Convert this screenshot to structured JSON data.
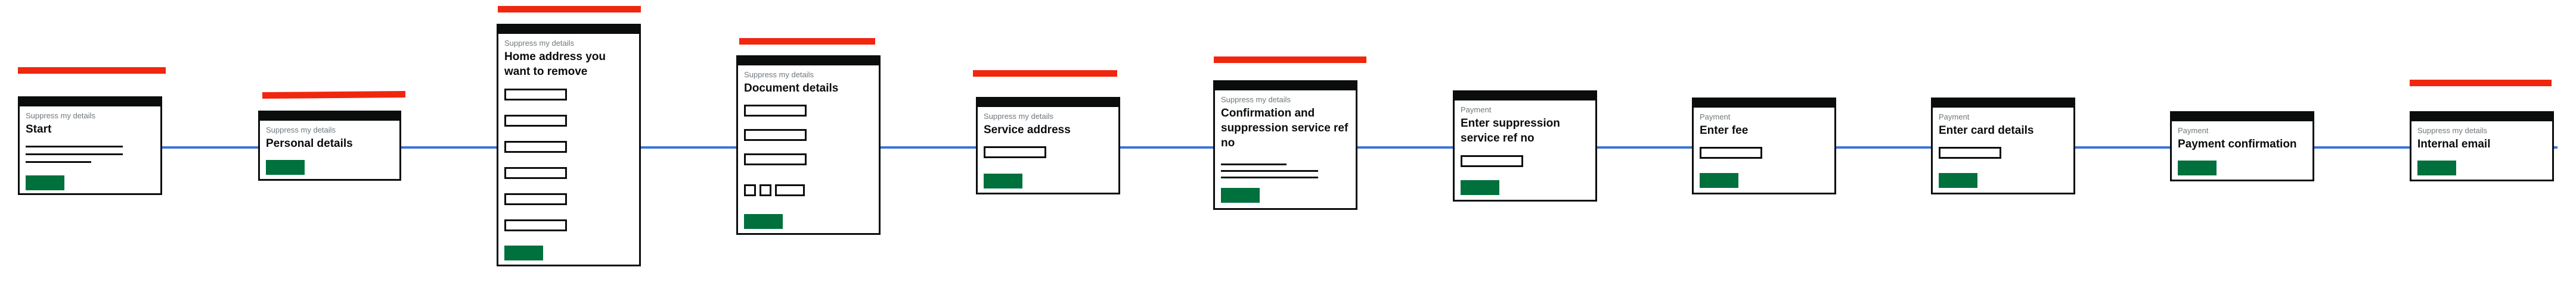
{
  "colors": {
    "flow_line": "#3d74d9",
    "annotation": "#f0270f",
    "card_border": "#0b0c0c",
    "button": "#00703c",
    "caption": "#6f777b"
  },
  "pages": [
    {
      "caption": "Suppress my details",
      "title": "Start",
      "annotated": true
    },
    {
      "caption": "Suppress my details",
      "title": "Personal details",
      "annotated": true
    },
    {
      "caption": "Suppress my details",
      "title": "Home address you want to remove",
      "annotated": true
    },
    {
      "caption": "Suppress my details",
      "title": "Document details",
      "annotated": true
    },
    {
      "caption": "Suppress my details",
      "title": "Service address",
      "annotated": true
    },
    {
      "caption": "Suppress my details",
      "title": "Confirmation and suppression service ref no",
      "annotated": true
    },
    {
      "caption": "Payment",
      "title": "Enter suppression service ref no",
      "annotated": false
    },
    {
      "caption": "Payment",
      "title": "Enter fee",
      "annotated": false
    },
    {
      "caption": "Payment",
      "title": "Enter card details",
      "annotated": false
    },
    {
      "caption": "Payment",
      "title": "Payment confirmation",
      "annotated": false
    },
    {
      "caption": "Suppress my details",
      "title": "Internal email",
      "annotated": true
    }
  ]
}
